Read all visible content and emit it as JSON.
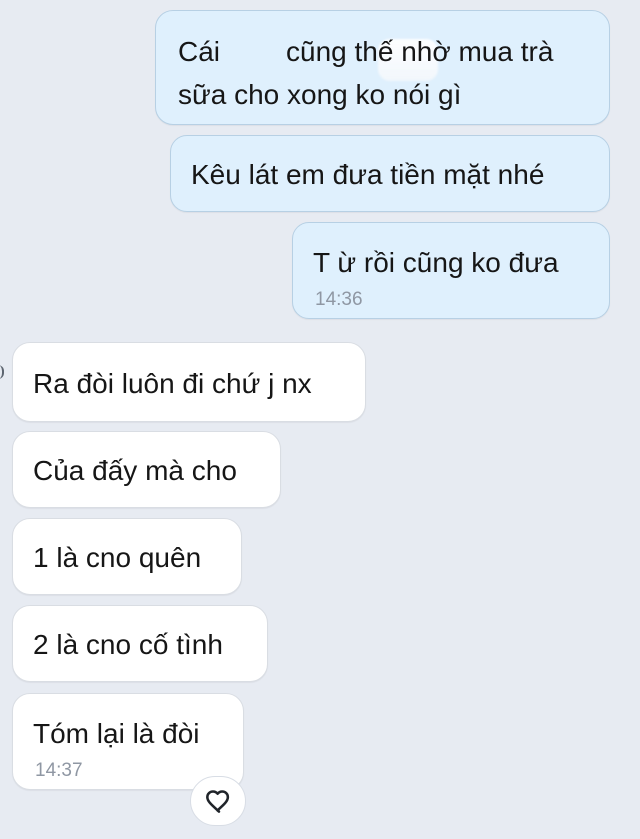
{
  "conversation": {
    "outgoing": [
      {
        "lines": [
          "Cái",
          "cũng thế nhờ mua trà",
          "sữa cho xong ko nói gì"
        ]
      },
      {
        "lines": [
          "Kêu lát em đưa tiền mặt nhé"
        ]
      },
      {
        "lines": [
          "T ừ rồi cũng ko đưa"
        ],
        "time": "14:36"
      }
    ],
    "incoming": [
      {
        "text": "Ra đòi luôn đi chứ j nx"
      },
      {
        "text": "Của đấy mà cho"
      },
      {
        "text": "1 là cno quên"
      },
      {
        "text": "2 là cno cố tình"
      },
      {
        "text": "Tóm lại là đòi",
        "time": "14:37"
      }
    ]
  },
  "reaction": {
    "icon": "heart-icon"
  },
  "colors": {
    "background": "#e7ebf2",
    "outgoing_bubble": "#dff0fd",
    "incoming_bubble": "#ffffff",
    "timestamp": "#8f97a3"
  }
}
